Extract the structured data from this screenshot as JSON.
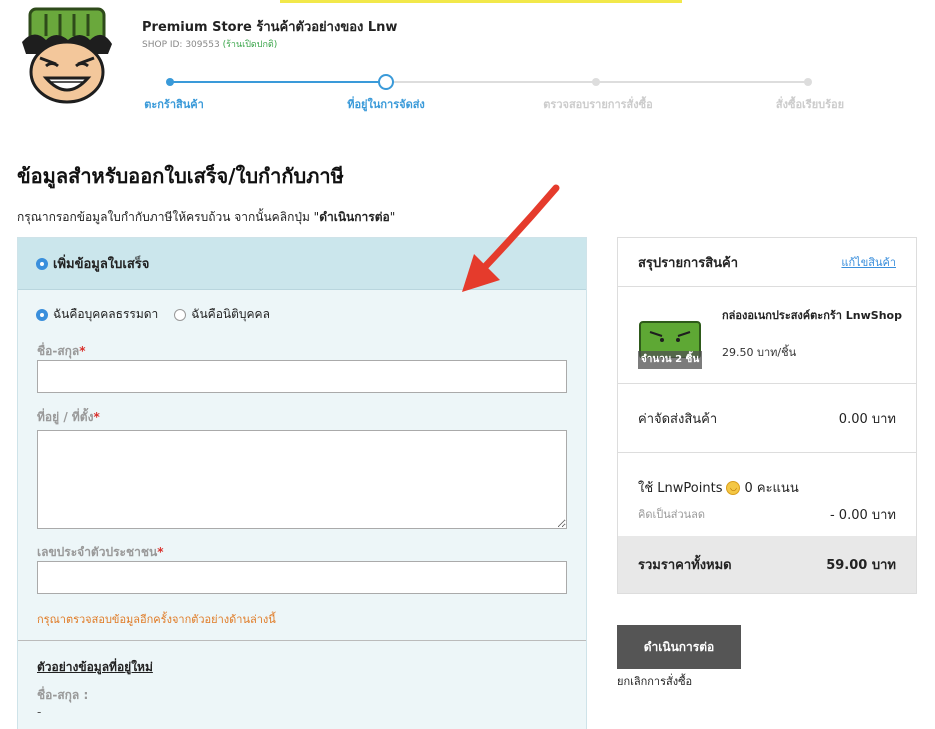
{
  "header": {
    "store_name": "Premium Store ร้านค้าตัวอย่างของ Lnw",
    "shop_id_label": "SHOP ID: 309553",
    "shop_status": "(ร้านเปิดปกติ)"
  },
  "steps": [
    {
      "label": "ตะกร้าสินค้า",
      "state": "done"
    },
    {
      "label": "ที่อยู่ในการจัดส่ง",
      "state": "current"
    },
    {
      "label": "ตรวจสอบรายการสั่งซื้อ",
      "state": "pending"
    },
    {
      "label": "สั่งซื้อเรียบร้อย",
      "state": "pending"
    }
  ],
  "page": {
    "title": "ข้อมูลสำหรับออกใบเสร็จ/ใบกำกับภาษี",
    "instruction_prefix": "กรุณากรอกข้อมูลใบกำกับภาษีให้ครบถ้วน จากนั้นคลิกปุ่ม \"",
    "instruction_bold": "ดำเนินการต่อ",
    "instruction_suffix": "\""
  },
  "form": {
    "section_title": "เพิ่มข้อมูลใบเสร็จ",
    "type_options": [
      {
        "label": "ฉันคือบุคคลธรรมดา",
        "selected": true
      },
      {
        "label": "ฉันคือนิติบุคคล",
        "selected": false
      }
    ],
    "name_label": "ชื่อ-สกุล",
    "address_label": "ที่อยู่ / ที่ตั้ง",
    "id_label": "เลขประจำตัวประชาชน",
    "required_mark": "*",
    "name_value": "",
    "address_value": "",
    "id_value": "",
    "hint": "กรุณาตรวจสอบข้อมูลอีกครั้งจากตัวอย่างด้านล่างนี้",
    "example_title": "ตัวอย่างข้อมูลที่อยู่ใหม่",
    "example_name_label": "ชื่อ-สกุล :",
    "example_name_value": "-"
  },
  "summary": {
    "title": "สรุปรายการสินค้า",
    "edit_label": "แก้ไขสินค้า",
    "product_name": "กล่องอเนกประสงค์ตะกร้า LnwShop",
    "product_price": "29.50 บาท/ชิ้น",
    "product_qty": "จำนวน 2 ชิ้น",
    "shipping_label": "ค่าจัดส่งสินค้า",
    "shipping_value": "0.00 บาท",
    "points_prefix": "ใช้ LnwPoints",
    "points_value": "0 คะแนน",
    "discount_label": "คิดเป็นส่วนลด",
    "discount_value": "- 0.00 บาท",
    "total_label": "รวมราคาทั้งหมด",
    "total_value": "59.00 บาท"
  },
  "actions": {
    "continue_label": "ดำเนินการต่อ",
    "cancel_label": "ยกเลิกการสั่งซื้อ"
  },
  "colors": {
    "accent": "#3a9ad9",
    "form_header_bg": "#cbe6ec",
    "button_bg": "#555555",
    "annotation_arrow": "#e53b2c",
    "hint": "#e07a24"
  }
}
